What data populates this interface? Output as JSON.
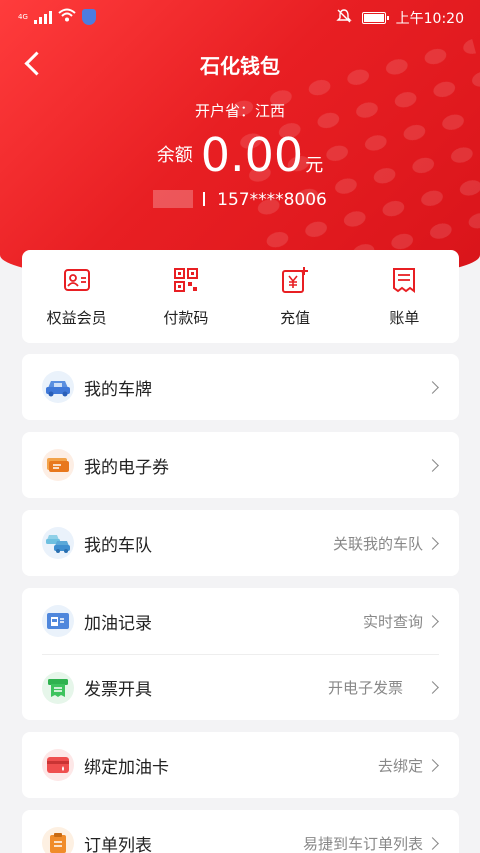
{
  "status_bar": {
    "network": "4G",
    "time": "上午10:20"
  },
  "header": {
    "title": "石化钱包"
  },
  "account": {
    "province_label": "开户省：江西",
    "balance_label": "余额",
    "balance": "0.00",
    "unit": "元",
    "phone": "157****8006"
  },
  "quick_actions": [
    {
      "label": "权益会员",
      "icon": "member-card-icon"
    },
    {
      "label": "付款码",
      "icon": "qr-code-icon"
    },
    {
      "label": "充值",
      "icon": "recharge-icon"
    },
    {
      "label": "账单",
      "icon": "bill-icon"
    }
  ],
  "menu": {
    "plate": {
      "label": "我的车牌",
      "hint": ""
    },
    "coupon": {
      "label": "我的电子券",
      "hint": ""
    },
    "fleet": {
      "label": "我的车队",
      "hint": "关联我的车队"
    },
    "fuel_records": {
      "label": "加油记录",
      "hint": "实时查询"
    },
    "invoice": {
      "label": "发票开具",
      "hint": "开电子发票"
    },
    "fuel_card": {
      "label": "绑定加油卡",
      "hint": "去绑定"
    },
    "orders": {
      "label": "订单列表",
      "hint": "易捷到车订单列表"
    }
  },
  "colors": {
    "brand_red": "#e81f23",
    "page_bg": "#f3f3f5"
  }
}
